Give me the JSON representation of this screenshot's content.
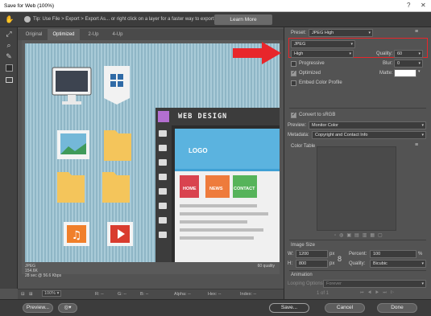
{
  "window": {
    "title": "Save for Web (100%)"
  },
  "tip": {
    "text": "Tip: Use File > Export > Export As... or right click on a layer for a faster way to export assets",
    "learn_more": "Learn More"
  },
  "tabs": [
    "Original",
    "Optimized",
    "2-Up",
    "4-Up"
  ],
  "preview": {
    "canvas": {
      "web_design_title": "WEB DESIGN",
      "logo": "LOGO",
      "buttons": [
        "HOME",
        "NEWS",
        "CONTACT"
      ]
    },
    "info_left": [
      "JPEG",
      "154.6K",
      "28 sec @ 56.6 Kbps"
    ],
    "info_right": "60 quality"
  },
  "status": {
    "zoom": "100%",
    "r": "R: --",
    "g": "G: --",
    "b": "B: --",
    "alpha": "Alpha: --",
    "hex": "Hex: --",
    "index": "Index: --"
  },
  "settings": {
    "preset_label": "Preset:",
    "preset_value": "JPEG High",
    "format": "JPEG",
    "compression": "High",
    "quality_label": "Quality:",
    "quality_value": "60",
    "progressive": "Progressive",
    "blur_label": "Blur:",
    "blur_value": "0",
    "optimized": "Optimized",
    "matte_label": "Matte:",
    "embed_color": "Embed Color Profile",
    "convert_srgb": "Convert to sRGB",
    "preview_label": "Preview:",
    "preview_value": "Monitor Color",
    "metadata_label": "Metadata:",
    "metadata_value": "Copyright and Contact Info",
    "color_table": "Color Table",
    "image_size": "Image Size",
    "w_label": "W:",
    "w_value": "1200",
    "h_label": "H:",
    "h_value": "800",
    "unit": "px",
    "percent_label": "Percent:",
    "percent_value": "100",
    "percent_unit": "%",
    "quality2_label": "Quality:",
    "quality2_value": "Bicubic",
    "animation": "Animation",
    "looping_label": "Looping Options:",
    "looping_value": "Forever",
    "frame_counter": "1 of 1"
  },
  "buttons": {
    "preview": "Preview...",
    "save": "Save...",
    "cancel": "Cancel",
    "done": "Done"
  },
  "colors": {
    "annotation_red": "#e8262b",
    "canvas_blue": "#9cc2d1"
  }
}
